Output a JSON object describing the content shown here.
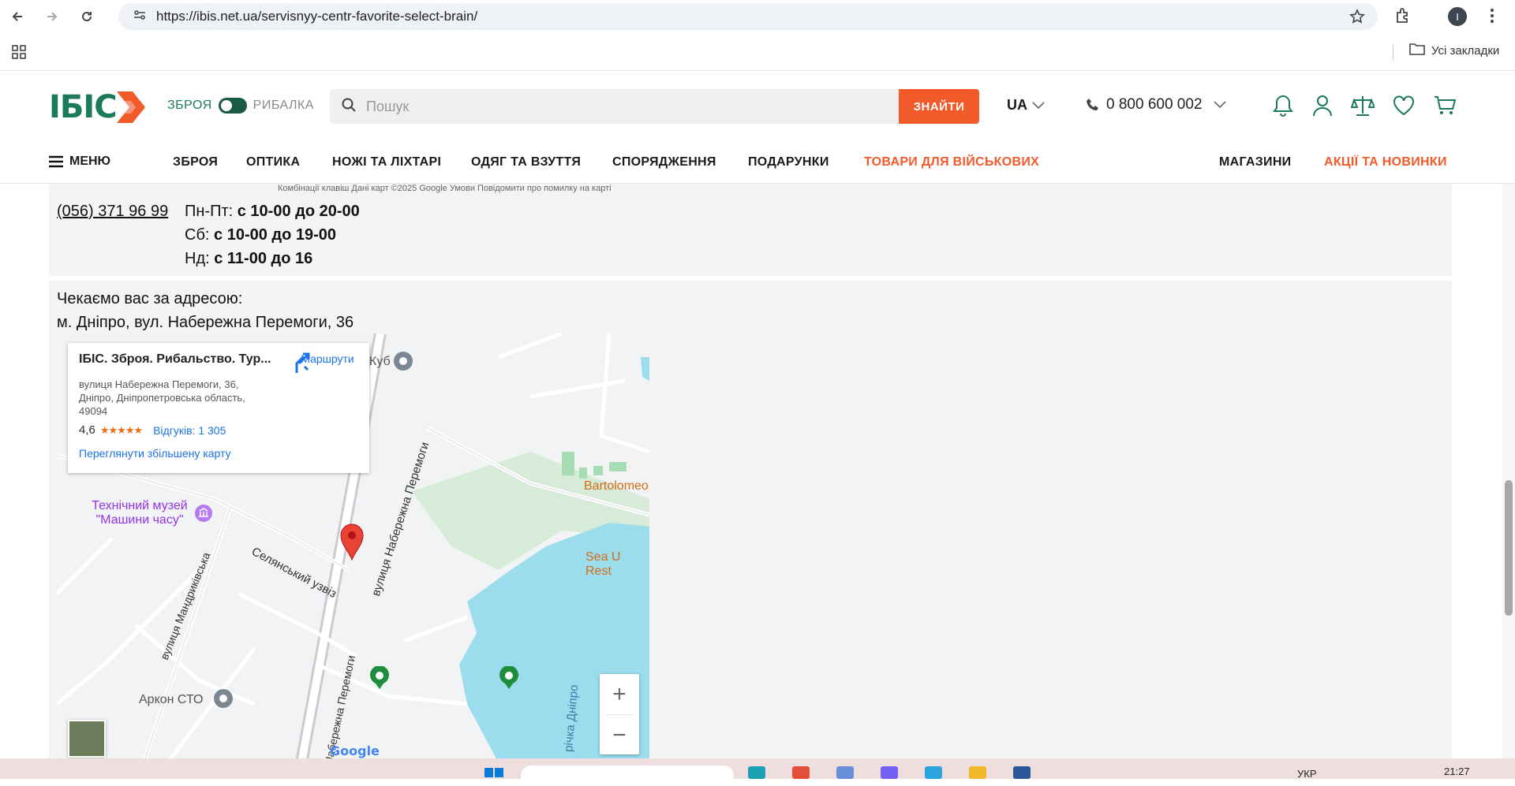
{
  "browser": {
    "url": "https://ibis.net.ua/servisnyy-centr-favorite-select-brain/",
    "profile_initial": "I",
    "bookmarks_folder": "Усі закладки"
  },
  "header": {
    "logo": "ІБІС",
    "toggle_left": "ЗБРОЯ",
    "toggle_right": "РИБАЛКА",
    "search_placeholder": "Пошук",
    "search_button": "ЗНАЙТИ",
    "language": "UA",
    "phone": "0 800 600 002"
  },
  "nav": {
    "menu_label": "МЕНЮ",
    "categories": [
      "ЗБРОЯ",
      "ОПТИКА",
      "НОЖІ ТА ЛІХТАРІ",
      "ОДЯГ ТА ВЗУТТЯ",
      "СПОРЯДЖЕННЯ",
      "ПОДАРУНКИ",
      "ТОВАРИ ДЛЯ ВІЙСЬКОВИХ"
    ],
    "stores": "МАГАЗИНИ",
    "promo": "АКЦІЇ ТА НОВИНКИ",
    "accent_color": "#f25a29",
    "brand_color": "#1a7a5a"
  },
  "store": {
    "map_strip_text": "Комбінації клавіш   Дані карт ©2025 Google   Умови   Повідомити про помилку на карті",
    "phone": "(056) 371 96 99",
    "hours": [
      {
        "day": "Пн-Пт:",
        "time": "с 10-00 до 20-00"
      },
      {
        "day": "Сб:",
        "time": "с 10-00 до 19-00"
      },
      {
        "day": "Нд:",
        "time": "с 11-00 до 16"
      }
    ],
    "address_intro": "Чекаємо вас за адресою:",
    "address": "м. Дніпро, вул. Набережна Перемоги, 36"
  },
  "map": {
    "card_title": "ІБІС. Зброя. Рибальство. Тур...",
    "card_address": "вулиця Набережна Перемоги, 36, Дніпро, Дніпропетровська область, 49094",
    "rating": "4,6",
    "reviews": "Відгуків: 1 305",
    "view_larger": "Переглянути збільшену карту",
    "routes": "Маршрути",
    "labels": {
      "museum": "Технічний музей \"Машини часу\"",
      "street1": "вулиця Набережна Перемоги",
      "street2": "Селянський узвіз",
      "street3": "вулиця Мандриківська",
      "street4": "Набережна Перемоги",
      "bartolomeo": "Bartolomeo",
      "sea": "Sea U Rest",
      "kub": "Куб",
      "arkon": "Аркон СТО",
      "river": "річка Дніпро",
      "google": "Google"
    }
  },
  "taskbar": {
    "lang": "УКР",
    "time": "21:27"
  }
}
